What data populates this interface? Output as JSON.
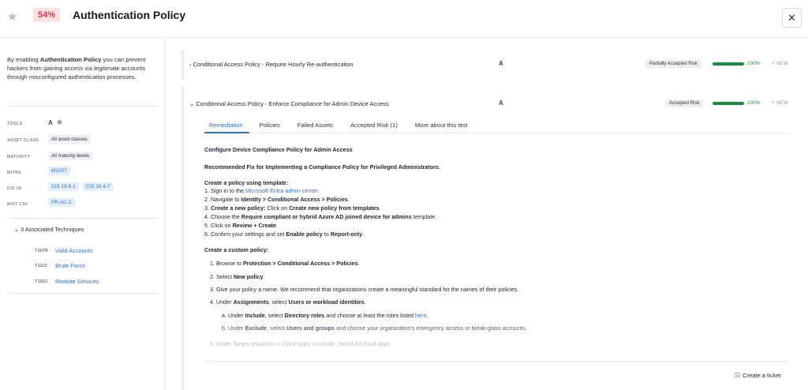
{
  "header": {
    "star_icon": "★",
    "score": "54%",
    "title": "Authentication Policy",
    "close_icon": "✕"
  },
  "sidebar": {
    "description_parts": [
      "By enabling ",
      "Authentication Policy",
      " you can prevent hackers from gaining access via legitimate accounts through misconfigured authentication processes."
    ],
    "meta": {
      "tools_label": "TOOLS",
      "tool_a_icon": "A",
      "tool_gear_icon": "✺",
      "asset_class_label": "ASSET CLASS",
      "asset_class_value": "All asset classes",
      "maturity_label": "MATURITY",
      "maturity_value": "All maturity levels",
      "mitre_label": "MITRE",
      "mitre_value": "M1027",
      "cis_label": "CIS 18",
      "cis_values": [
        "CIS 18 6.1",
        "CIS 18 4.7"
      ],
      "nist_label": "NIST CSF",
      "nist_value": "PR.AC-1"
    },
    "associated_toggle": "⌄  3 Associated Techniques",
    "techniques": [
      {
        "id": "T1078",
        "name": "Valid Accounts"
      },
      {
        "id": "T1110",
        "name": "Brute Force"
      },
      {
        "id": "T1021",
        "name": "Remote Services"
      }
    ]
  },
  "cards": [
    {
      "title": "›  Conditional Access Policy - Require Hourly Re-authentication",
      "tool_icon": "A",
      "status": "Partially Accepted Risk",
      "progress": 100,
      "progress_text": "100%",
      "new_label": "↗  NEW"
    },
    {
      "title": "⌄  Conditional Access Policy - Enforce Compliance for Admin Device Access",
      "tool_icon": "A",
      "status": "Accepted Risk",
      "progress": 100,
      "progress_text": "100%",
      "new_label": "↗  NEW"
    }
  ],
  "tabs": [
    "Remediation",
    "Policies",
    "Failed Assets",
    "Accepted Risk (1)",
    "More about this test"
  ],
  "remediation": {
    "heading": "Configure Device Compliance Policy for Admin Access",
    "fix_heading": "Recommended Fix for Implementing a Compliance Policy for Privileged Administrators.",
    "template_heading": "Create a policy using template:",
    "t1_a": "1. Sign in to the ",
    "t1_link": "Microsoft Entra admin center",
    "t1_b": ".",
    "t2_a": "2. Navigate to ",
    "t2_b": "Identity > Conditional Access > Policies",
    "t2_c": ".",
    "t3_a": "3. ",
    "t3_b": "Create a new policy:",
    "t3_c": " Click on ",
    "t3_d": "Create new policy from templates",
    "t3_e": ".",
    "t4_a": "4. Choose the ",
    "t4_b": "Require compliant or hybrid Azure AD joined device for admins",
    "t4_c": " template.",
    "t5_a": "5. Click on ",
    "t5_b": "Review + Create",
    "t5_c": ".",
    "t6_a": "6. Confirm your settings and set ",
    "t6_b": "Enable policy",
    "t6_c": " to ",
    "t6_d": "Report-only",
    "t6_e": ".",
    "custom_heading": "Create a custom policy:",
    "c1_a": "1. Browse to ",
    "c1_b": "Protection > Conditional Access > Policies",
    "c1_c": ".",
    "c2_a": "2. Select ",
    "c2_b": "New policy",
    "c2_c": ".",
    "c3": "3. Give your policy a name. We recommend that organizations create a meaningful standard for the names of their policies.",
    "c4_a": "4. Under ",
    "c4_b": "Assignments",
    "c4_c": ", select ",
    "c4_d": "Users or workload identities",
    "c4_e": ".",
    "ca_a": "a. Under ",
    "ca_b": "Include",
    "ca_c": ", select ",
    "ca_d": "Directory roles",
    "ca_e": " and choose at least the roles listed ",
    "ca_link": "here",
    "ca_f": ".",
    "cb_a": "b. Under ",
    "cb_b": "Exclude",
    "cb_c": ", select ",
    "cb_d": "Users and groups",
    "cb_e": " and choose your organization's emergency access or break-glass accounts.",
    "c5": "5. Under Target resources > Cloud apps > Include, select All cloud apps."
  },
  "ticket_icon": "☷",
  "ticket_label": "Create a ticket"
}
